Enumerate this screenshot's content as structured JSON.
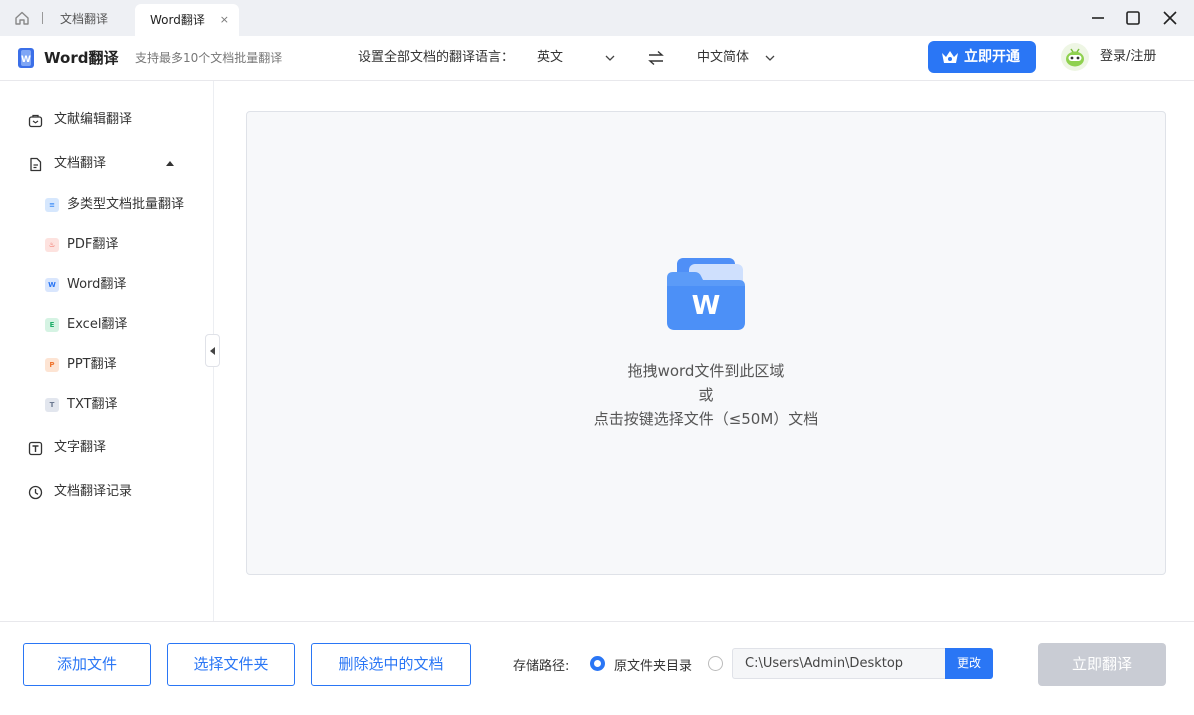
{
  "titlebar": {
    "tabs": [
      {
        "label": "文档翻译",
        "active": false
      },
      {
        "label": "Word翻译",
        "active": true
      }
    ],
    "close_glyph": "×"
  },
  "header": {
    "app_name": "Word翻译",
    "subtitle": "支持最多10个文档批量翻译",
    "lang_label": "设置全部文档的翻译语言：",
    "source_lang": "英文",
    "target_lang": "中文简体",
    "vip_button": "立即开通",
    "login": "登录/注册"
  },
  "sidebar": {
    "items": [
      {
        "label": "文献编辑翻译",
        "icon": "bag-icon"
      },
      {
        "label": "文档翻译",
        "icon": "document-icon",
        "expanded": true
      },
      {
        "label": "文字翻译",
        "icon": "text-icon"
      },
      {
        "label": "文档翻译记录",
        "icon": "clock-icon"
      }
    ],
    "sub_items": [
      {
        "label": "多类型文档批量翻译",
        "badge": "≡",
        "color": "#3f8cf7",
        "bg": "#d6e7fd"
      },
      {
        "label": "PDF翻译",
        "badge": "♨",
        "color": "#ea4b3c",
        "bg": "#fde2df"
      },
      {
        "label": "Word翻译",
        "badge": "W",
        "color": "#2a76f5",
        "bg": "#d9e6fd"
      },
      {
        "label": "Excel翻译",
        "badge": "E",
        "color": "#1fae6a",
        "bg": "#d5f3e3"
      },
      {
        "label": "PPT翻译",
        "badge": "P",
        "color": "#f0752f",
        "bg": "#fde4d3"
      },
      {
        "label": "TXT翻译",
        "badge": "T",
        "color": "#6b7890",
        "bg": "#e2e6ee"
      }
    ]
  },
  "dropzone": {
    "line1": "拖拽word文件到此区域",
    "line2": "或",
    "line3": "点击按键选择文件（≤50M）文档"
  },
  "bottom": {
    "add_file": "添加文件",
    "select_folder": "选择文件夹",
    "delete_selected": "删除选中的文档",
    "path_label": "存储路径:",
    "option_original": "原文件夹目录",
    "custom_path": "C:\\Users\\Admin\\Desktop",
    "change": "更改",
    "translate": "立即翻译"
  },
  "colors": {
    "accent": "#2a76f5",
    "disabled": "#c9ccd4"
  }
}
